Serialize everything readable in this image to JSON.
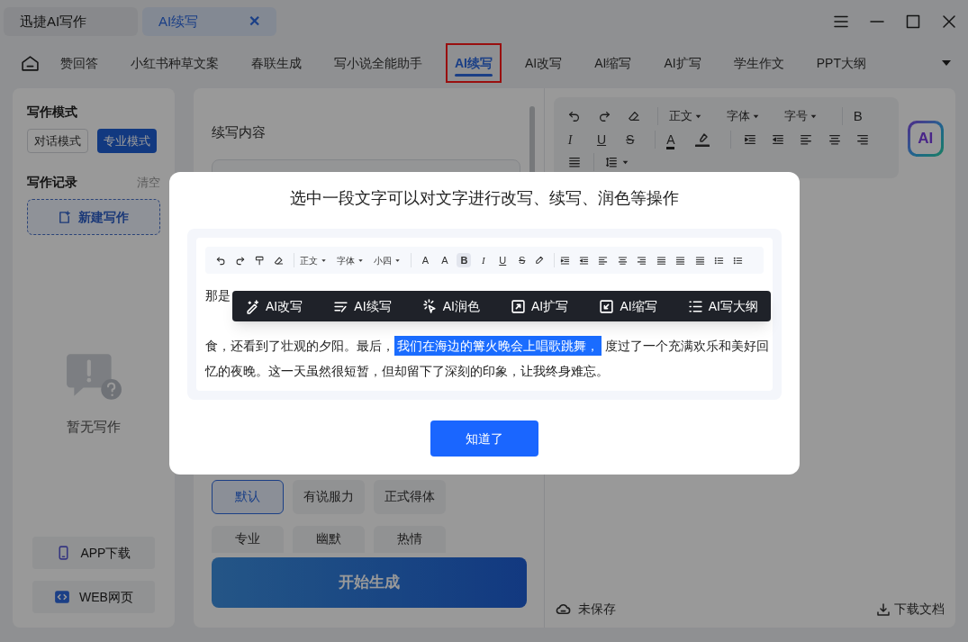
{
  "window": {
    "tabs": [
      {
        "label": "迅捷AI写作",
        "selected": false
      },
      {
        "label": "AI续写",
        "selected": true,
        "close": "✕"
      }
    ]
  },
  "nav": {
    "items": [
      {
        "label": "赞回答",
        "selected": false
      },
      {
        "label": "小红书种草文案",
        "selected": false
      },
      {
        "label": "春联生成",
        "selected": false
      },
      {
        "label": "写小说全能助手",
        "selected": false
      },
      {
        "label": "AI续写",
        "selected": true
      },
      {
        "label": "AI改写",
        "selected": false
      },
      {
        "label": "AI缩写",
        "selected": false
      },
      {
        "label": "AI扩写",
        "selected": false
      },
      {
        "label": "学生作文",
        "selected": false
      },
      {
        "label": "PPT大纲",
        "selected": false
      }
    ]
  },
  "sidebar": {
    "mode_title": "写作模式",
    "modes": [
      {
        "label": "对话模式",
        "selected": false
      },
      {
        "label": "专业模式",
        "selected": true
      }
    ],
    "history_title": "写作记录",
    "clear": "清空",
    "new_button": "新建写作",
    "empty_text": "暂无写作",
    "links": [
      {
        "label": "APP下载",
        "kind": "app"
      },
      {
        "label": "WEB网页",
        "kind": "web"
      }
    ]
  },
  "editor": {
    "label": "续写内容",
    "tones": [
      {
        "label": "默认",
        "selected": true
      },
      {
        "label": "有说服力",
        "selected": false
      },
      {
        "label": "正式得体",
        "selected": false
      },
      {
        "label": "专业",
        "selected": false
      },
      {
        "label": "幽默",
        "selected": false
      },
      {
        "label": "热情",
        "selected": false
      }
    ],
    "generate_button": "开始生成"
  },
  "document": {
    "styles": [
      "正文",
      "字体",
      "字号"
    ],
    "letters": [
      "B",
      "I",
      "U",
      "S",
      "A"
    ],
    "ai_badge": "AI",
    "status": "未保存",
    "download": "下载文档"
  },
  "dialog": {
    "title": "选中一段文字可以对文字进行改写、续写、润色等操作",
    "toolbar": {
      "styles": [
        "正文",
        "字体",
        "小四"
      ],
      "letters": [
        {
          "label": "A",
          "selected": false
        },
        {
          "label": "A",
          "selected": false
        },
        {
          "label": "B",
          "selected": true
        },
        {
          "label": "I",
          "selected": false
        },
        {
          "label": "U",
          "selected": false
        },
        {
          "label": "S",
          "selected": false
        }
      ]
    },
    "ai_menu": [
      {
        "label": "AI改写",
        "kind": "rewrite"
      },
      {
        "label": "AI续写",
        "kind": "continue"
      },
      {
        "label": "AI润色",
        "kind": "polish"
      },
      {
        "label": "AI扩写",
        "kind": "expand"
      },
      {
        "label": "AI缩写",
        "kind": "shrink"
      },
      {
        "label": "AI写大纲",
        "kind": "outline"
      }
    ],
    "text_start": "那是",
    "text_before": "食，还看到了壮观的夕阳。最后，",
    "text_selected": "我们在海边的篝火晚会上唱歌跳舞，",
    "text_after": "度过了一个充满欢乐和美好回忆的夜晚。这一天虽然很短暂，但却留下了深刻的印象，让我终身难忘。",
    "ok_button": "知道了"
  }
}
